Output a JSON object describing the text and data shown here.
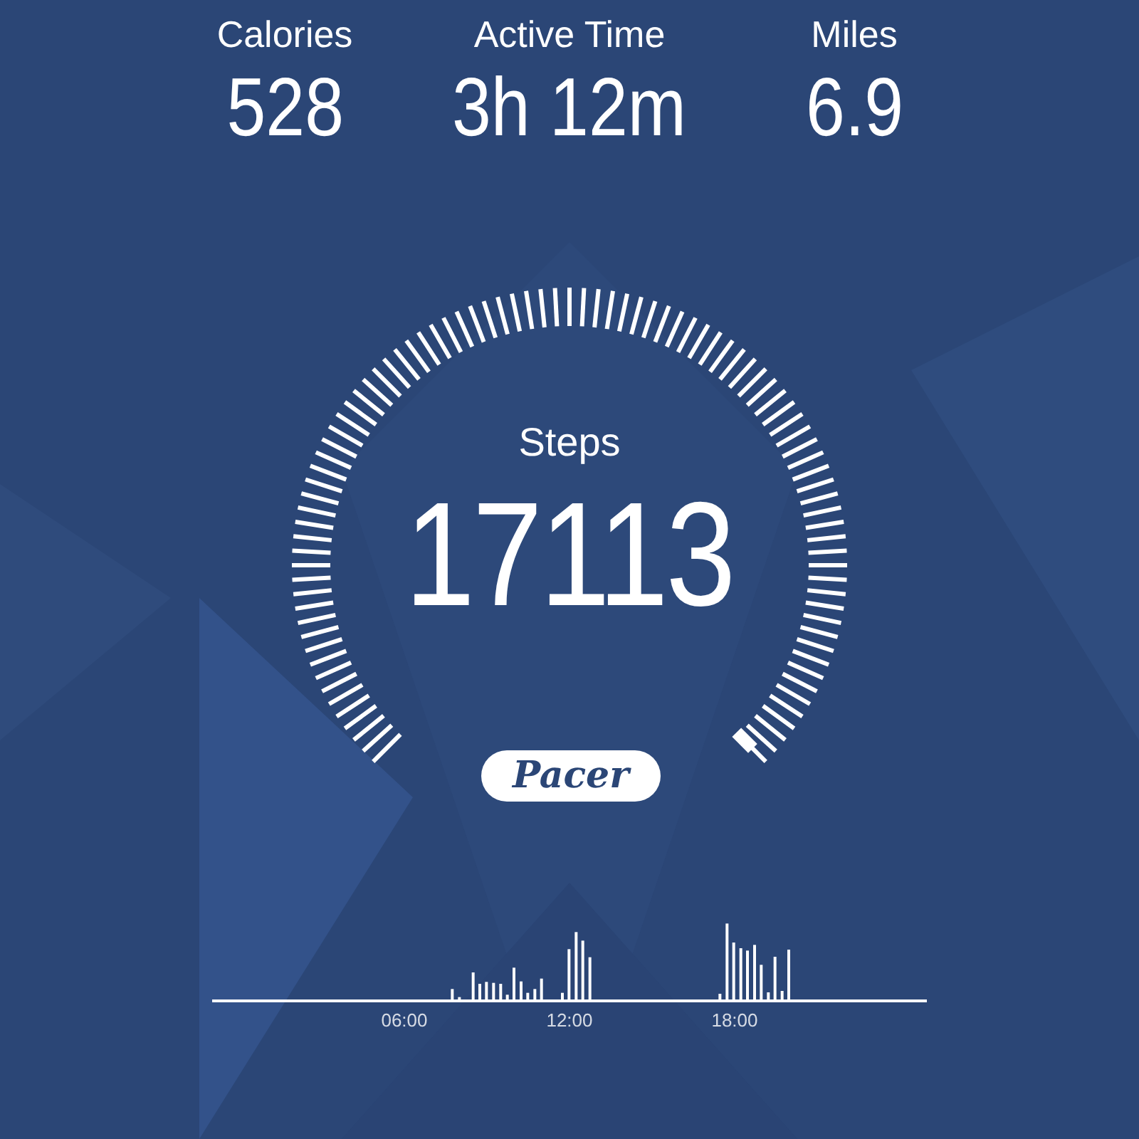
{
  "stats": [
    {
      "label": "Calories",
      "value": "528"
    },
    {
      "label": "Active Time",
      "value": "3h 12m"
    },
    {
      "label": "Miles",
      "value": "6.9"
    }
  ],
  "gauge": {
    "label": "Steps",
    "value": "17113"
  },
  "logo": "Pacer",
  "activity_chart": {
    "x_labels": [
      "06:00",
      "12:00",
      "18:00"
    ]
  }
}
